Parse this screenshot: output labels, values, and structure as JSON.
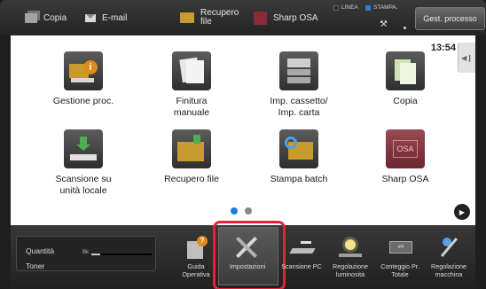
{
  "topbar": {
    "shortcuts": [
      {
        "label": "Copia",
        "icon": "copy-icon"
      },
      {
        "label": "E-mail",
        "icon": "mail-icon"
      },
      {
        "label": "Recupero\nfile",
        "icon": "folder-icon"
      },
      {
        "label": "Sharp OSA",
        "icon": "osa-icon"
      }
    ],
    "status_line": "LINEA",
    "status_print": "STAMPA.",
    "job_status_button": "Gest. processo"
  },
  "clock": "13:54",
  "apps": [
    {
      "label": "Gestione proc.",
      "icon": "job-manage-icon"
    },
    {
      "label": "Finitura\nmanuale",
      "icon": "finishing-icon"
    },
    {
      "label": "Imp. cassetto/\nImp. carta",
      "icon": "tray-settings-icon"
    },
    {
      "label": "Copia",
      "icon": "copy-icon"
    },
    {
      "label": "Scansione su\nunità locale",
      "icon": "scan-local-icon"
    },
    {
      "label": "Recupero file",
      "icon": "retrieve-file-icon"
    },
    {
      "label": "Stampa batch",
      "icon": "batch-print-icon"
    },
    {
      "label": "Sharp OSA",
      "icon": "sharp-osa-icon"
    }
  ],
  "pagination": {
    "current": 1,
    "total": 2
  },
  "toner": {
    "title": "Quantità\nToner",
    "color_label": "Bk",
    "level": 0.15
  },
  "bottom_tools": [
    {
      "label": "Guida\nOperativa",
      "icon": "guide-icon"
    },
    {
      "label": "Impostazioni",
      "icon": "settings-icon",
      "selected": true
    },
    {
      "label": "Scansione PC",
      "icon": "pc-scan-icon"
    },
    {
      "label": "Regolazione\nluminosità",
      "icon": "brightness-icon"
    },
    {
      "label": "Conteggio Pr.\nTotale",
      "icon": "counter-icon"
    },
    {
      "label": "Regolazione\nmacchina",
      "icon": "machine-adjust-icon"
    }
  ],
  "colors": {
    "accent": "#1d7bd6",
    "selection": "#e0233b",
    "folder": "#c99a2e"
  }
}
